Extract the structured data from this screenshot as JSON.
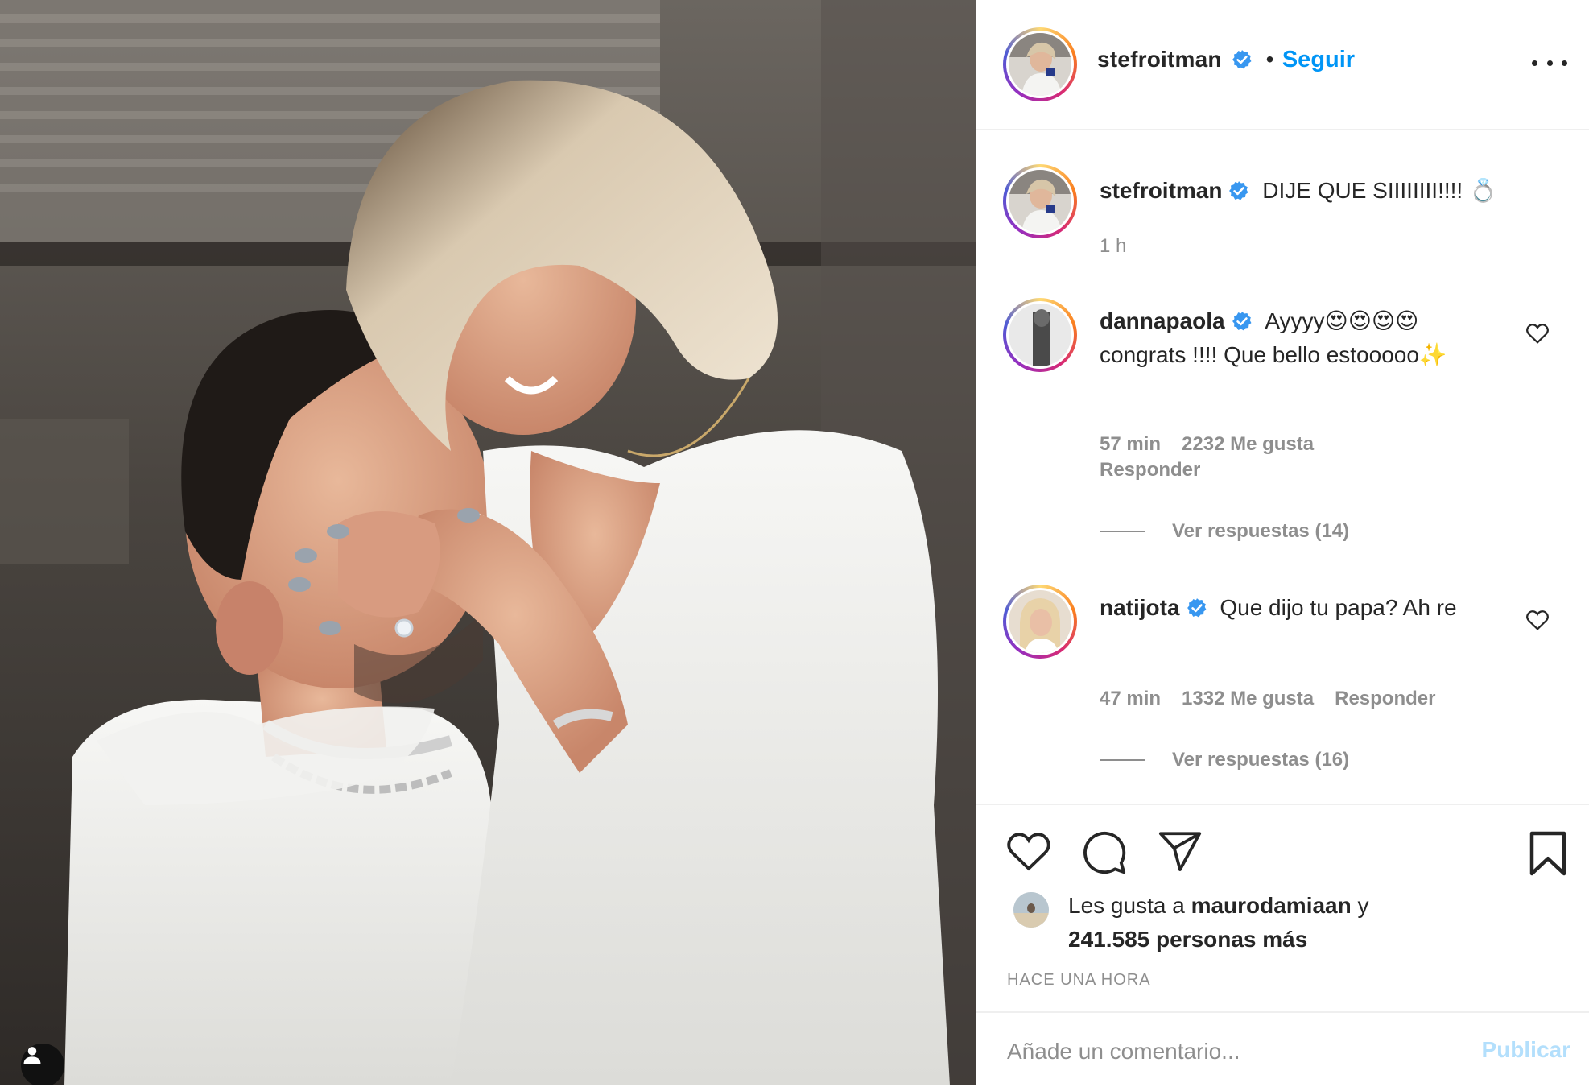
{
  "post_author": {
    "username": "stefroitman",
    "separator": "•",
    "follow_label": "Seguir"
  },
  "caption": {
    "username": "stefroitman",
    "text": "DIJE QUE SIIIIIIII!!!! 💍",
    "time": "1 h"
  },
  "comments": [
    {
      "username": "dannapaola",
      "text": "Ayyyy😍😍😍😍 congrats !!!! Que bello estooooo✨",
      "time": "57 min",
      "likes": "2232 Me gusta",
      "reply_label": "Responder",
      "view_replies": "Ver respuestas (14)"
    },
    {
      "username": "natijota",
      "text": "Que dijo tu papa? Ah re",
      "time": "47 min",
      "likes": "1332 Me gusta",
      "reply_label": "Responder",
      "view_replies": "Ver respuestas (16)"
    }
  ],
  "likes": {
    "prefix": "Les gusta a ",
    "user": "maurodamiaan",
    "connector": " y",
    "count": "241.585 personas más"
  },
  "timestamp": "HACE UNA HORA",
  "add_comment": {
    "placeholder": "Añade un comentario...",
    "publish_label": "Publicar"
  },
  "colors": {
    "link_blue": "#0095f6",
    "publish_disabled": "#b3dffc",
    "muted_text": "#8e8e8e",
    "verified_blue": "#3897f0"
  },
  "icons": [
    "user-tag-icon",
    "more-options-icon",
    "verified-badge-icon",
    "heart-icon",
    "comment-icon",
    "share-icon",
    "bookmark-icon"
  ]
}
